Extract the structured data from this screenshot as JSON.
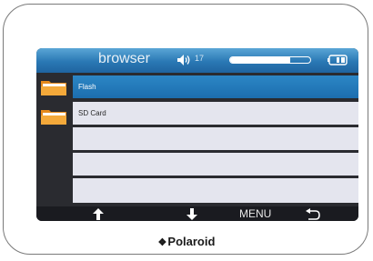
{
  "header": {
    "title": "browser",
    "volume_value": "17",
    "playback_progress": 0.75
  },
  "list": {
    "items": [
      {
        "label": "Flash",
        "selected": true,
        "icon": "folder-icon"
      },
      {
        "label": "SD Card",
        "selected": false,
        "icon": "folder-icon"
      },
      {
        "label": "",
        "selected": false
      },
      {
        "label": "",
        "selected": false
      },
      {
        "label": "",
        "selected": false
      }
    ]
  },
  "footer": {
    "menu_label": "MENU",
    "icons": [
      "arrow-up-icon",
      "arrow-down-icon",
      "return-icon"
    ]
  },
  "brand": {
    "name": "Polaroid",
    "mark": "❖"
  },
  "colors": {
    "accent": "#2c86c5",
    "row_bg": "#e4e5ee"
  }
}
